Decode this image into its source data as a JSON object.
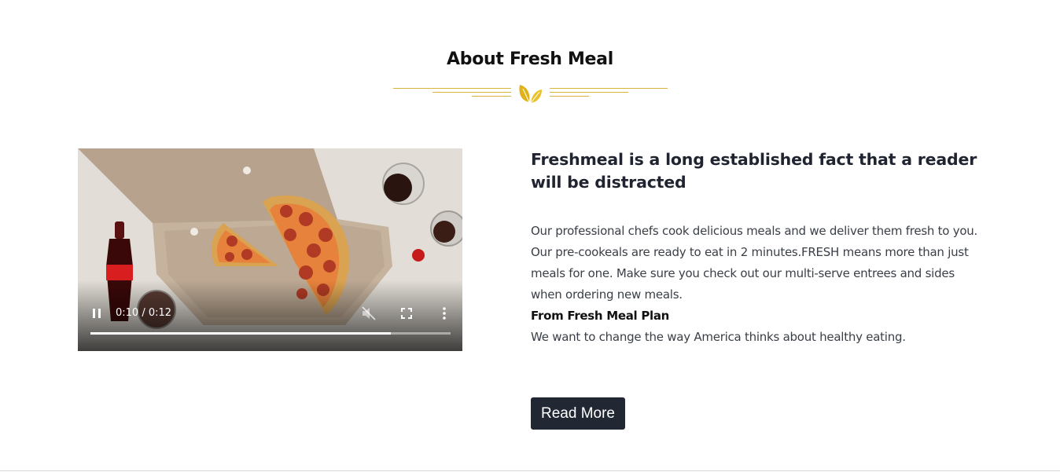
{
  "section": {
    "title": "About Fresh Meal",
    "divider_icon": "leaf-icon",
    "accent_color": "#d9b43c"
  },
  "video": {
    "time_display": "0:10 / 0:12",
    "progress_fraction": 0.835,
    "state": "playing",
    "muted": true,
    "icons": [
      "pause-icon",
      "mute-icon",
      "fullscreen-icon",
      "more-options-icon"
    ]
  },
  "content": {
    "headline": "Freshmeal is a long established fact that a reader will be distracted",
    "body": "Our professional chefs cook delicious meals and we deliver them fresh to you. Our pre-cookeals are ready to eat in 2 minutes.FRESH means more than just meals for one. Make sure you check out our multi-serve entrees and sides when ordering new meals.",
    "sub_heading": "From Fresh Meal Plan",
    "tagline": "We want to change the way America thinks about healthy eating.",
    "button_label": "Read More",
    "button_color": "#212733"
  }
}
